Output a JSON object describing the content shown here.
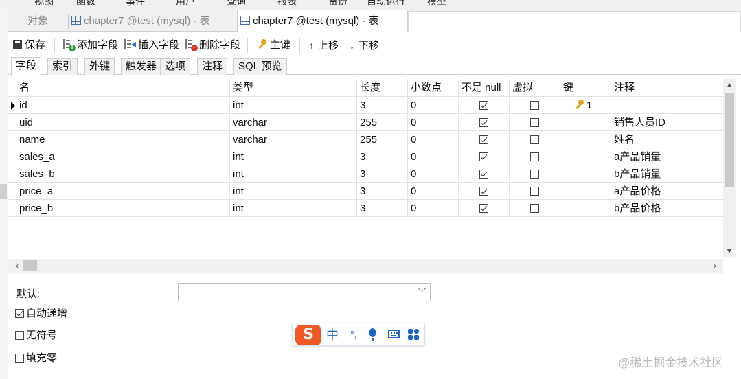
{
  "menu": [
    "视图",
    "函数",
    "事件",
    "用户",
    "查询",
    "报表",
    "备份",
    "自动运行",
    "模型"
  ],
  "tabs": {
    "objects": "对象",
    "tab1": "chapter7 @test (mysql) - 表",
    "tab2": "chapter7 @test (mysql) - 表"
  },
  "toolbar": {
    "save": "保存",
    "add_field": "添加字段",
    "insert_field": "插入字段",
    "delete_field": "删除字段",
    "primary_key": "主键",
    "move_up": "上移",
    "move_down": "下移"
  },
  "subtabs": [
    "字段",
    "索引",
    "外键",
    "触发器",
    "选项",
    "注释",
    "SQL 预览"
  ],
  "columns": {
    "name": "名",
    "type": "类型",
    "length": "长度",
    "decimals": "小数点",
    "not_null": "不是 null",
    "virtual": "虚拟",
    "key": "键",
    "comment": "注释"
  },
  "rows": [
    {
      "name": "id",
      "type": "int",
      "length": "3",
      "decimals": "0",
      "not_null": true,
      "virtual": false,
      "key": "1",
      "comment": ""
    },
    {
      "name": "uid",
      "type": "varchar",
      "length": "255",
      "decimals": "0",
      "not_null": true,
      "virtual": false,
      "key": "",
      "comment": "销售人员ID"
    },
    {
      "name": "name",
      "type": "varchar",
      "length": "255",
      "decimals": "0",
      "not_null": true,
      "virtual": false,
      "key": "",
      "comment": "姓名"
    },
    {
      "name": "sales_a",
      "type": "int",
      "length": "3",
      "decimals": "0",
      "not_null": true,
      "virtual": false,
      "key": "",
      "comment": "a产品销量"
    },
    {
      "name": "sales_b",
      "type": "int",
      "length": "3",
      "decimals": "0",
      "not_null": true,
      "virtual": false,
      "key": "",
      "comment": "b产品销量"
    },
    {
      "name": "price_a",
      "type": "int",
      "length": "3",
      "decimals": "0",
      "not_null": true,
      "virtual": false,
      "key": "",
      "comment": "a产品价格"
    },
    {
      "name": "price_b",
      "type": "int",
      "length": "3",
      "decimals": "0",
      "not_null": true,
      "virtual": false,
      "key": "",
      "comment": "b产品价格"
    }
  ],
  "props": {
    "default_label": "默认:",
    "default_value": "",
    "auto_increment": {
      "label": "自动递增",
      "checked": true
    },
    "unsigned": {
      "label": "无符号",
      "checked": false
    },
    "zerofill": {
      "label": "填充零",
      "checked": false
    }
  },
  "ime": {
    "logo": "S",
    "mode": "中",
    "punct": "°,"
  },
  "watermark": "@稀土掘金技术社区"
}
